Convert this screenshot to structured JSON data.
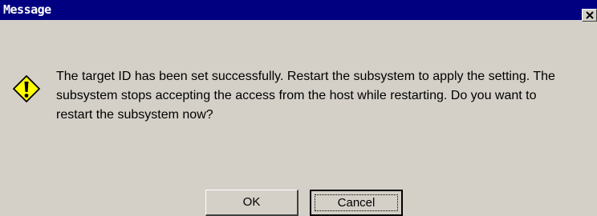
{
  "window": {
    "title": "Message"
  },
  "titlebar": {
    "close_icon": "close-icon"
  },
  "body": {
    "icon": "warning-exclamation-icon",
    "icon_color": "#ffff00",
    "message": "The target ID has been set successfully. Restart the subsystem to apply the setting. The\nsubsystem stops accepting the access from the host while restarting. Do you want to\nrestart the subsystem now?"
  },
  "buttons": {
    "ok_label": "OK",
    "cancel_label": "Cancel",
    "default": "Cancel"
  },
  "colors": {
    "titlebar": "#000080",
    "face": "#d4d0c8"
  }
}
